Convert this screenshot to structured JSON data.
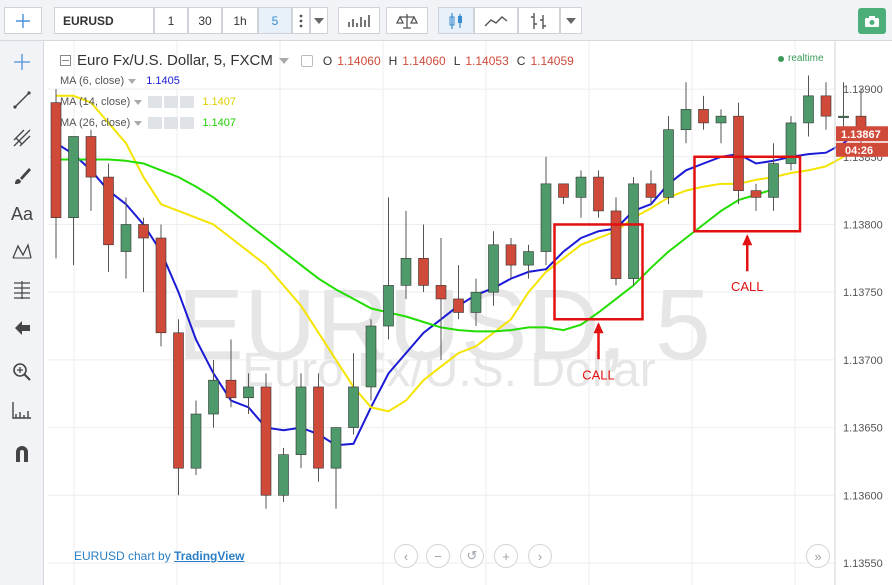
{
  "toolbar": {
    "symbol": "EURUSD",
    "intervals": [
      "1",
      "30",
      "1h",
      "5"
    ],
    "active_interval": "5"
  },
  "sidebar": {
    "icons": [
      "crosshair-icon",
      "trend-line-icon",
      "pitchfork-icon",
      "brush-icon",
      "text-icon",
      "pattern-icon",
      "fib-icon",
      "arrow-left-icon",
      "zoom-icon",
      "measure-icon",
      "magnet-icon"
    ]
  },
  "chart_header": {
    "title": "Euro Fx/U.S. Dollar, 5, FXCM",
    "o_label": "O",
    "o_value": "1.14060",
    "h_label": "H",
    "h_value": "1.14060",
    "l_label": "L",
    "l_value": "1.14053",
    "c_label": "C",
    "c_value": "1.14059",
    "realtime": "realtime"
  },
  "legend": [
    {
      "label": "MA (6, close)",
      "value": "1.1405",
      "color": "#1a1ad6"
    },
    {
      "label": "MA (14, close)",
      "value": "1.1407",
      "color": "#f4e400"
    },
    {
      "label": "MA (26, close)",
      "value": "1.1407",
      "color": "#22dd00"
    }
  ],
  "watermark": {
    "symbol": "EURUSD, 5",
    "name": "Euro Fx/U.S. Dollar"
  },
  "price_badge": {
    "price": "1.13867",
    "countdown": "04:26"
  },
  "footer": {
    "prefix": "EURUSD chart by ",
    "brand": "TradingView"
  },
  "colors": {
    "up": "#4e9a6a",
    "down": "#d04a3a",
    "ma6": "#1a1ad6",
    "ma14": "#f4e400",
    "ma26": "#22dd00",
    "annotation": "#e21010"
  },
  "chart_data": {
    "type": "candlestick",
    "ylim": [
      1.1354,
      1.1392
    ],
    "y_ticks": [
      "1.13900",
      "1.13850",
      "1.13800",
      "1.13750",
      "1.13700",
      "1.13650",
      "1.13600",
      "1.13550"
    ],
    "candles": [
      {
        "o": 1.1389,
        "h": 1.139,
        "l": 1.13775,
        "c": 1.13805
      },
      {
        "o": 1.13805,
        "h": 1.1386,
        "l": 1.1377,
        "c": 1.13865
      },
      {
        "o": 1.13865,
        "h": 1.1387,
        "l": 1.1381,
        "c": 1.13835
      },
      {
        "o": 1.13835,
        "h": 1.13845,
        "l": 1.13765,
        "c": 1.13785
      },
      {
        "o": 1.1378,
        "h": 1.1382,
        "l": 1.1376,
        "c": 1.138
      },
      {
        "o": 1.138,
        "h": 1.13805,
        "l": 1.1375,
        "c": 1.1379
      },
      {
        "o": 1.1379,
        "h": 1.138,
        "l": 1.1371,
        "c": 1.1372
      },
      {
        "o": 1.1372,
        "h": 1.1373,
        "l": 1.136,
        "c": 1.1362
      },
      {
        "o": 1.1362,
        "h": 1.1367,
        "l": 1.13615,
        "c": 1.1366
      },
      {
        "o": 1.1366,
        "h": 1.137,
        "l": 1.1365,
        "c": 1.13685
      },
      {
        "o": 1.13685,
        "h": 1.13715,
        "l": 1.13665,
        "c": 1.13672
      },
      {
        "o": 1.13672,
        "h": 1.1369,
        "l": 1.1366,
        "c": 1.1368
      },
      {
        "o": 1.1368,
        "h": 1.1369,
        "l": 1.1359,
        "c": 1.136
      },
      {
        "o": 1.136,
        "h": 1.13635,
        "l": 1.13595,
        "c": 1.1363
      },
      {
        "o": 1.1363,
        "h": 1.1369,
        "l": 1.1362,
        "c": 1.1368
      },
      {
        "o": 1.1368,
        "h": 1.1369,
        "l": 1.1361,
        "c": 1.1362
      },
      {
        "o": 1.1362,
        "h": 1.1365,
        "l": 1.1359,
        "c": 1.1365
      },
      {
        "o": 1.1365,
        "h": 1.13705,
        "l": 1.13645,
        "c": 1.1368
      },
      {
        "o": 1.1368,
        "h": 1.1373,
        "l": 1.1367,
        "c": 1.13725
      },
      {
        "o": 1.13725,
        "h": 1.1382,
        "l": 1.13715,
        "c": 1.13755
      },
      {
        "o": 1.13755,
        "h": 1.1381,
        "l": 1.13745,
        "c": 1.13775
      },
      {
        "o": 1.13775,
        "h": 1.138,
        "l": 1.1375,
        "c": 1.13755
      },
      {
        "o": 1.13755,
        "h": 1.1379,
        "l": 1.137,
        "c": 1.13745
      },
      {
        "o": 1.13745,
        "h": 1.1377,
        "l": 1.1373,
        "c": 1.13735
      },
      {
        "o": 1.13735,
        "h": 1.1376,
        "l": 1.13725,
        "c": 1.1375
      },
      {
        "o": 1.1375,
        "h": 1.13795,
        "l": 1.1374,
        "c": 1.13785
      },
      {
        "o": 1.13785,
        "h": 1.1379,
        "l": 1.1376,
        "c": 1.1377
      },
      {
        "o": 1.1377,
        "h": 1.13785,
        "l": 1.1376,
        "c": 1.1378
      },
      {
        "o": 1.1378,
        "h": 1.1385,
        "l": 1.1377,
        "c": 1.1383
      },
      {
        "o": 1.1383,
        "h": 1.1383,
        "l": 1.13815,
        "c": 1.1382
      },
      {
        "o": 1.1382,
        "h": 1.1384,
        "l": 1.13805,
        "c": 1.13835
      },
      {
        "o": 1.13835,
        "h": 1.1384,
        "l": 1.13805,
        "c": 1.1381
      },
      {
        "o": 1.1381,
        "h": 1.1382,
        "l": 1.13755,
        "c": 1.1376
      },
      {
        "o": 1.1376,
        "h": 1.13835,
        "l": 1.13755,
        "c": 1.1383
      },
      {
        "o": 1.1383,
        "h": 1.1384,
        "l": 1.13815,
        "c": 1.1382
      },
      {
        "o": 1.1382,
        "h": 1.1388,
        "l": 1.13815,
        "c": 1.1387
      },
      {
        "o": 1.1387,
        "h": 1.13905,
        "l": 1.1386,
        "c": 1.13885
      },
      {
        "o": 1.13885,
        "h": 1.13895,
        "l": 1.1387,
        "c": 1.13875
      },
      {
        "o": 1.13875,
        "h": 1.13885,
        "l": 1.1386,
        "c": 1.1388
      },
      {
        "o": 1.1388,
        "h": 1.1389,
        "l": 1.13815,
        "c": 1.13825
      },
      {
        "o": 1.13825,
        "h": 1.1383,
        "l": 1.1381,
        "c": 1.1382
      },
      {
        "o": 1.1382,
        "h": 1.1386,
        "l": 1.1381,
        "c": 1.13845
      },
      {
        "o": 1.13845,
        "h": 1.1388,
        "l": 1.1384,
        "c": 1.13875
      },
      {
        "o": 1.13875,
        "h": 1.1391,
        "l": 1.13865,
        "c": 1.13895
      },
      {
        "o": 1.13895,
        "h": 1.13905,
        "l": 1.1387,
        "c": 1.1388
      },
      {
        "o": 1.1388,
        "h": 1.13905,
        "l": 1.1387,
        "c": 1.1388
      },
      {
        "o": 1.1388,
        "h": 1.139,
        "l": 1.1386,
        "c": 1.13867
      }
    ],
    "series": [
      {
        "name": "MA (6, close)",
        "values": [
          1.1386,
          1.13852,
          1.1384,
          1.13825,
          1.13815,
          1.138,
          1.1378,
          1.1375,
          1.13715,
          1.1369,
          1.1367,
          1.13665,
          1.1365,
          1.13648,
          1.1365,
          1.13645,
          1.13637,
          1.13638,
          1.13665,
          1.1369,
          1.13705,
          1.1372,
          1.1373,
          1.1374,
          1.13748,
          1.13753,
          1.1376,
          1.13765,
          1.13767,
          1.1378,
          1.1379,
          1.13795,
          1.13797,
          1.1381,
          1.13815,
          1.1383,
          1.1384,
          1.13845,
          1.1385,
          1.13852,
          1.13845,
          1.13847,
          1.1385,
          1.13852,
          1.13853,
          1.1386,
          1.1387
        ]
      },
      {
        "name": "MA (14, close)",
        "values": [
          1.13895,
          1.13895,
          1.1389,
          1.13875,
          1.1386,
          1.13835,
          1.13815,
          1.1381,
          1.13805,
          1.138,
          1.1379,
          1.1378,
          1.1377,
          1.13755,
          1.1374,
          1.1372,
          1.137,
          1.1368,
          1.13665,
          1.13662,
          1.1367,
          1.13685,
          1.13695,
          1.13705,
          1.1371,
          1.1372,
          1.1373,
          1.1375,
          1.13765,
          1.13775,
          1.13785,
          1.1379,
          1.13795,
          1.13805,
          1.13812,
          1.1382,
          1.13825,
          1.13828,
          1.1383,
          1.1383,
          1.13833,
          1.13835,
          1.13838,
          1.1384,
          1.13843,
          1.1385,
          1.13857
        ]
      },
      {
        "name": "MA (26, close)",
        "values": [
          1.13848,
          1.13848,
          1.13848,
          1.13848,
          1.13847,
          1.13845,
          1.1384,
          1.13835,
          1.13828,
          1.1382,
          1.1381,
          1.138,
          1.1379,
          1.1378,
          1.1377,
          1.1376,
          1.13752,
          1.13745,
          1.13738,
          1.13735,
          1.13732,
          1.13728,
          1.13724,
          1.13722,
          1.13721,
          1.13721,
          1.13722,
          1.13724,
          1.13724,
          1.13722,
          1.13726,
          1.13735,
          1.13745,
          1.13755,
          1.13768,
          1.1378,
          1.1379,
          1.138,
          1.1381,
          1.13818,
          1.13822,
          1.13826
        ]
      }
    ],
    "annotations": [
      {
        "label": "CALL",
        "from_index": 29,
        "to_index": 33,
        "y_low": 1.1373,
        "y_high": 1.138
      },
      {
        "label": "CALL",
        "from_index": 37,
        "to_index": 42,
        "y_low": 1.13795,
        "y_high": 1.1385
      }
    ]
  }
}
